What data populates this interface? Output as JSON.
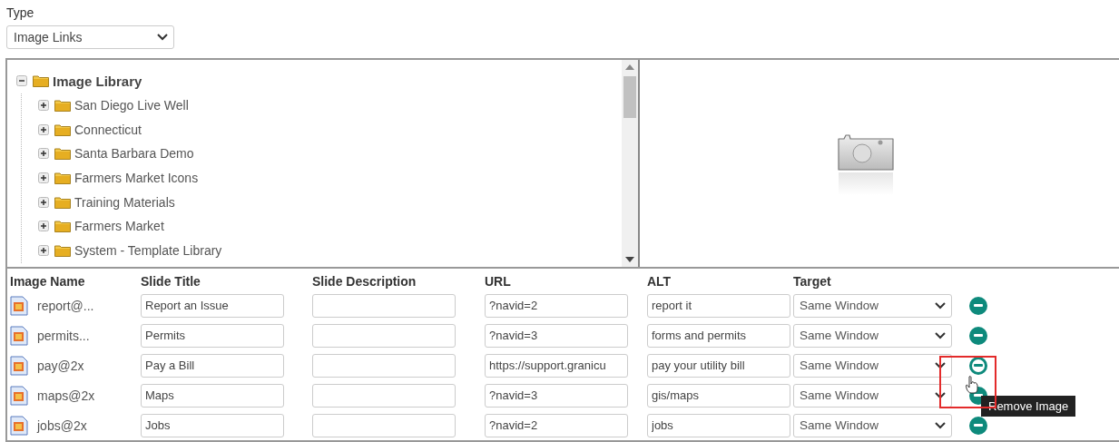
{
  "type_field": {
    "label": "Type",
    "value": "Image Links"
  },
  "tree": {
    "label": "Image Library",
    "expanded": true,
    "children": [
      {
        "label": "San Diego Live Well",
        "expanded": false
      },
      {
        "label": "Connecticut",
        "expanded": false
      },
      {
        "label": "Santa Barbara Demo",
        "expanded": false
      },
      {
        "label": "Farmers Market Icons",
        "expanded": false
      },
      {
        "label": "Training Materials",
        "expanded": false
      },
      {
        "label": "Farmers Market",
        "expanded": false
      },
      {
        "label": "System - Template Library",
        "expanded": false
      }
    ]
  },
  "table": {
    "columns": [
      "Image Name",
      "Slide Title",
      "Slide Description",
      "URL",
      "ALT",
      "Target"
    ],
    "rows": [
      {
        "image_name": "report@...",
        "slide_title": "Report an Issue",
        "url": "?navid=2",
        "alt": "report it",
        "target": "Same Window",
        "hovered": false
      },
      {
        "image_name": "permits...",
        "slide_title": "Permits",
        "url": "?navid=3",
        "alt": "forms and permits",
        "target": "Same Window",
        "hovered": false
      },
      {
        "image_name": "pay@2x",
        "slide_title": "Pay a Bill",
        "url": "https://support.granicu",
        "alt": "pay your utility bill",
        "target": "Same Window",
        "hovered": true
      },
      {
        "image_name": "maps@2x",
        "slide_title": "Maps",
        "url": "?navid=3",
        "alt": "gis/maps",
        "target": "Same Window",
        "hovered": false
      },
      {
        "image_name": "jobs@2x",
        "slide_title": "Jobs",
        "url": "?navid=2",
        "alt": "jobs",
        "target": "Same Window",
        "hovered": false
      }
    ]
  },
  "tooltip": "Remove Image"
}
